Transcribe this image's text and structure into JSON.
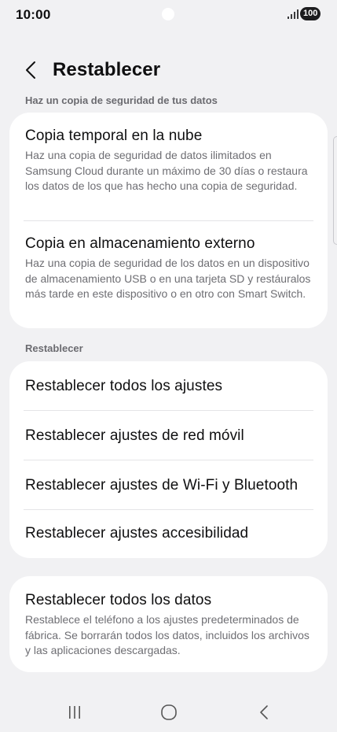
{
  "status_bar": {
    "time": "10:00",
    "battery": "100",
    "icons": [
      "signal-icon",
      "battery-icon"
    ]
  },
  "header": {
    "title": "Restablecer",
    "back_icon": "chevron-left-icon"
  },
  "backup_section": {
    "label": "Haz un copia de seguridad de tus datos",
    "items": [
      {
        "title": "Copia temporal en la nube",
        "description": "Haz una copia de seguridad de datos ilimitados en Samsung Cloud durante un máximo de 30 días o restaura los datos de los que has hecho una copia de seguridad."
      },
      {
        "title": "Copia en almacenamiento externo",
        "description": "Haz una copia de seguridad de los datos en un dispositivo de almacenamiento USB o en una tarjeta SD y restáuralos más tarde en este dispositivo o en otro con Smart Switch."
      }
    ]
  },
  "reset_section": {
    "label": "Restablecer",
    "items": [
      {
        "title": "Restablecer todos los ajustes"
      },
      {
        "title": "Restablecer ajustes de red móvil"
      },
      {
        "title": "Restablecer ajustes de Wi-Fi y Bluetooth"
      },
      {
        "title": "Restablecer ajustes accesibilidad"
      }
    ]
  },
  "factory_reset": {
    "title": "Restablecer todos los datos",
    "description": "Restablece el teléfono a los ajustes predeterminados de fábrica. Se borrarán todos los datos, incluidos los archivos y las aplicaciones descargadas."
  },
  "nav_bar": {
    "icons": [
      "recent-apps-icon",
      "home-icon",
      "back-icon"
    ]
  }
}
